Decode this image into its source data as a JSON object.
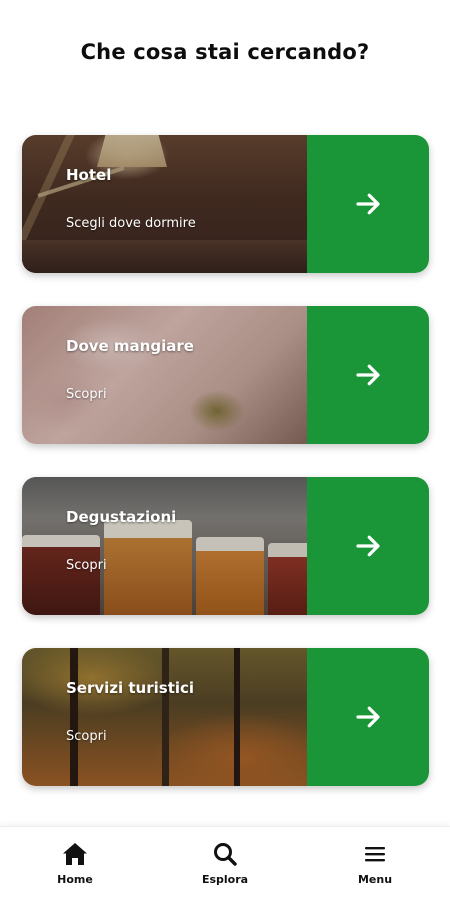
{
  "header": {
    "title": "Che cosa stai cercando?"
  },
  "cards": [
    {
      "title": "Hotel",
      "subtitle": "Scegli dove dormire",
      "action_icon": "arrow-right-icon",
      "image": "hotel-lamp-photo"
    },
    {
      "title": "Dove mangiare",
      "subtitle": "Scopri",
      "action_icon": "arrow-right-icon",
      "image": "food-photo"
    },
    {
      "title": "Degustazioni",
      "subtitle": "Scopri",
      "action_icon": "arrow-right-icon",
      "image": "beer-glasses-photo"
    },
    {
      "title": "Servizi turistici",
      "subtitle": "Scopri",
      "action_icon": "arrow-right-icon",
      "image": "autumn-forest-photo"
    }
  ],
  "bottom_nav": {
    "items": [
      {
        "label": "Home",
        "icon": "home-icon"
      },
      {
        "label": "Esplora",
        "icon": "search-icon"
      },
      {
        "label": "Menu",
        "icon": "menu-icon"
      }
    ]
  },
  "colors": {
    "accent_green": "#1a9639",
    "text": "#111111",
    "background": "#ffffff"
  }
}
